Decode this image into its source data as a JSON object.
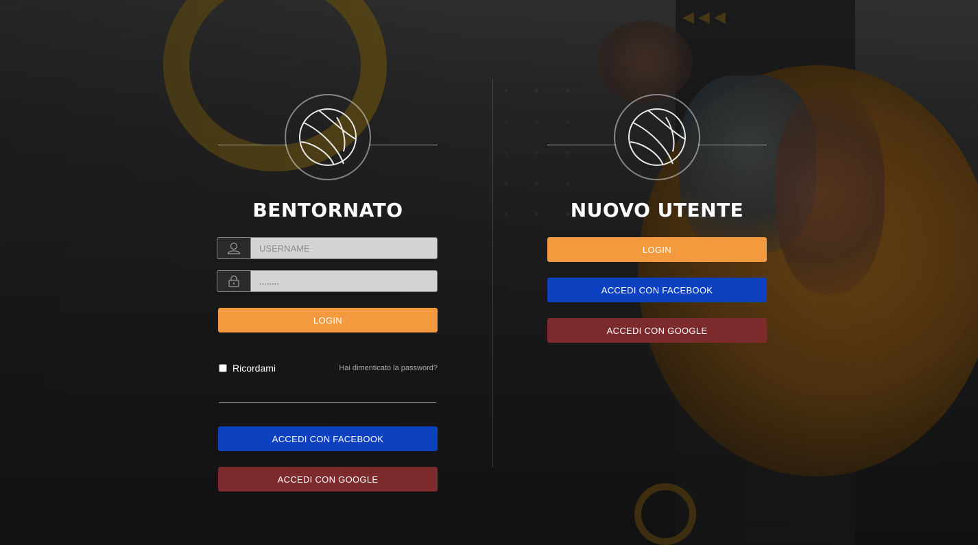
{
  "login_panel": {
    "title": "BENTORNATO",
    "username_placeholder": "USERNAME",
    "password_value": "........",
    "login_label": "LOGIN",
    "remember_label": "Ricordami",
    "forgot_label": "Hai dimenticato la password?",
    "facebook_label": "ACCEDI CON FACEBOOK",
    "google_label": "ACCEDI CON GOOGLE"
  },
  "register_panel": {
    "title": "NUOVO UTENTE",
    "login_label": "LOGIN",
    "facebook_label": "ACCEDI CON FACEBOOK",
    "google_label": "ACCEDI CON GOOGLE"
  },
  "icons": {
    "logo": "basketball-icon",
    "username": "user-icon",
    "password": "lock-icon"
  },
  "colors": {
    "login": "#f39a3e",
    "facebook": "#0e41c0",
    "google": "#7c2a2c",
    "accent_background": "#8a5410"
  }
}
